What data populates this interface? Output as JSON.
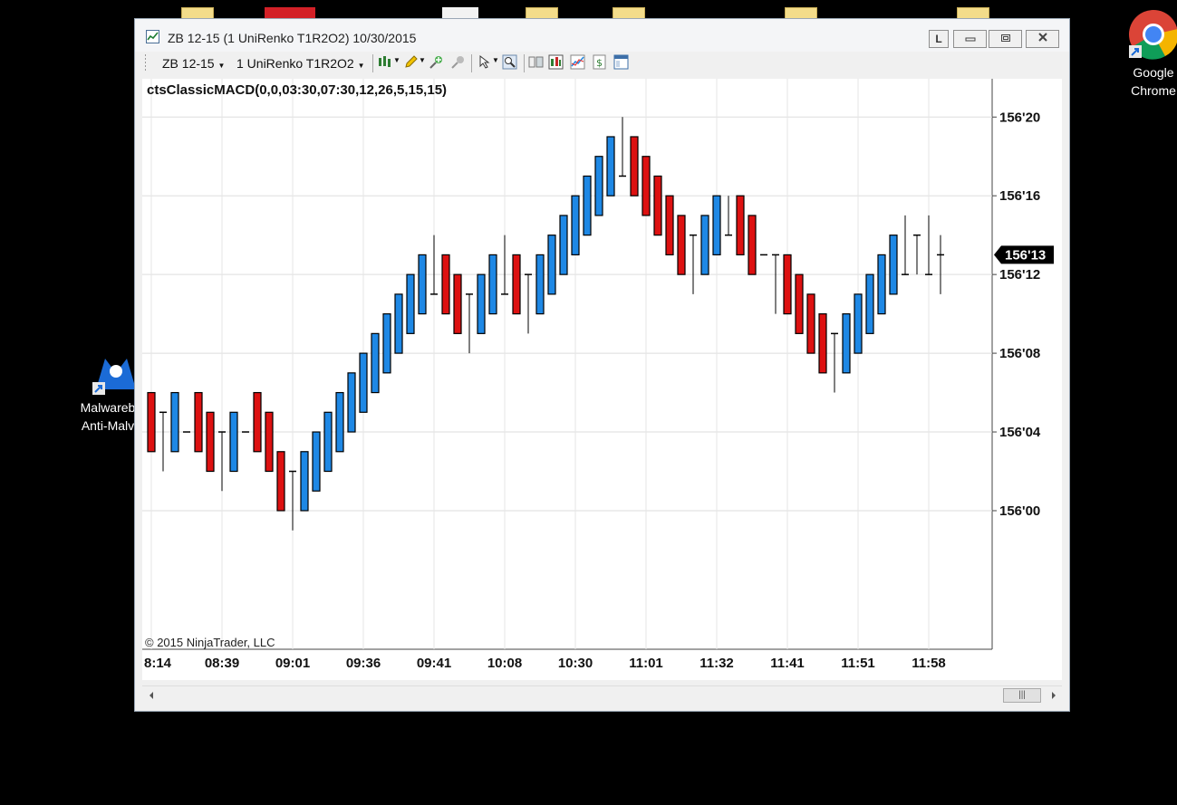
{
  "desktop": {
    "icons": [
      {
        "name": "malwarebytes",
        "label_line1": "Malwareb",
        "label_line2": "Anti-Malv"
      },
      {
        "name": "chrome",
        "label_line1": "Google",
        "label_line2": "Chrome"
      }
    ]
  },
  "window": {
    "title": "ZB 12-15 (1 UniRenko T1R2O2)  10/30/2015",
    "buttons": {
      "link": "L"
    }
  },
  "toolbar": {
    "instrument": "ZB 12-15",
    "period": "1 UniRenko T1R2O2"
  },
  "chart_data": {
    "type": "candlestick",
    "indicator_label": "ctsClassicMACD(0,0,03:30,07:30,12,26,5,15,15)",
    "copyright": "© 2015 NinjaTrader, LLC",
    "y_labels": [
      "156'20",
      "156'16",
      "156'12",
      "156'08",
      "156'04",
      "156'00"
    ],
    "y_label_values": [
      156.625,
      156.5,
      156.375,
      156.25,
      156.125,
      156.0
    ],
    "ylim": [
      155.78,
      156.68
    ],
    "last_price_label": "156'13",
    "last_price": 156.40625,
    "x_labels": [
      "8:14",
      "08:39",
      "09:01",
      "09:36",
      "09:41",
      "10:08",
      "10:30",
      "11:01",
      "11:32",
      "11:41",
      "11:51",
      "11:58"
    ],
    "x_label_bar_index": [
      0,
      6,
      12,
      18,
      24,
      30,
      36,
      42,
      48,
      54,
      60,
      66
    ],
    "colors": {
      "up": "#1e88e5",
      "down": "#dd1111",
      "doji": "#000000"
    },
    "bars": [
      {
        "o": 6,
        "h": 6,
        "l": 3,
        "c": 3
      },
      {
        "o": 5,
        "h": 5,
        "l": 2,
        "c": 5
      },
      {
        "o": 3,
        "h": 6,
        "l": 3,
        "c": 6
      },
      {
        "o": 4,
        "h": 4,
        "l": 4,
        "c": 4
      },
      {
        "o": 6,
        "h": 6,
        "l": 3,
        "c": 3
      },
      {
        "o": 5,
        "h": 5,
        "l": 2,
        "c": 2
      },
      {
        "o": 4,
        "h": 4,
        "l": 1,
        "c": 4
      },
      {
        "o": 2,
        "h": 5,
        "l": 2,
        "c": 5
      },
      {
        "o": 4,
        "h": 4,
        "l": 4,
        "c": 4
      },
      {
        "o": 6,
        "h": 6,
        "l": 3,
        "c": 3
      },
      {
        "o": 5,
        "h": 5,
        "l": 2,
        "c": 2
      },
      {
        "o": 3,
        "h": 3,
        "l": 0,
        "c": 0
      },
      {
        "o": 2,
        "h": 2,
        "l": -1,
        "c": 2
      },
      {
        "o": 0,
        "h": 3,
        "l": 0,
        "c": 3
      },
      {
        "o": 1,
        "h": 4,
        "l": 1,
        "c": 4
      },
      {
        "o": 2,
        "h": 5,
        "l": 2,
        "c": 5
      },
      {
        "o": 3,
        "h": 6,
        "l": 3,
        "c": 6
      },
      {
        "o": 4,
        "h": 7,
        "l": 4,
        "c": 7
      },
      {
        "o": 5,
        "h": 8,
        "l": 5,
        "c": 8
      },
      {
        "o": 6,
        "h": 9,
        "l": 6,
        "c": 9
      },
      {
        "o": 7,
        "h": 10,
        "l": 7,
        "c": 10
      },
      {
        "o": 8,
        "h": 11,
        "l": 8,
        "c": 11
      },
      {
        "o": 9,
        "h": 12,
        "l": 9,
        "c": 12
      },
      {
        "o": 10,
        "h": 13,
        "l": 10,
        "c": 13
      },
      {
        "o": 11,
        "h": 14,
        "l": 11,
        "c": 11
      },
      {
        "o": 13,
        "h": 13,
        "l": 10,
        "c": 10
      },
      {
        "o": 12,
        "h": 12,
        "l": 9,
        "c": 9
      },
      {
        "o": 11,
        "h": 11,
        "l": 8,
        "c": 11
      },
      {
        "o": 9,
        "h": 12,
        "l": 9,
        "c": 12
      },
      {
        "o": 10,
        "h": 13,
        "l": 10,
        "c": 13
      },
      {
        "o": 11,
        "h": 14,
        "l": 11,
        "c": 11
      },
      {
        "o": 13,
        "h": 13,
        "l": 10,
        "c": 10
      },
      {
        "o": 12,
        "h": 12,
        "l": 9,
        "c": 12
      },
      {
        "o": 10,
        "h": 13,
        "l": 10,
        "c": 13
      },
      {
        "o": 11,
        "h": 14,
        "l": 11,
        "c": 14
      },
      {
        "o": 12,
        "h": 15,
        "l": 12,
        "c": 15
      },
      {
        "o": 13,
        "h": 16,
        "l": 13,
        "c": 16
      },
      {
        "o": 14,
        "h": 17,
        "l": 14,
        "c": 17
      },
      {
        "o": 15,
        "h": 18,
        "l": 15,
        "c": 18
      },
      {
        "o": 16,
        "h": 19,
        "l": 16,
        "c": 19
      },
      {
        "o": 17,
        "h": 20,
        "l": 17,
        "c": 17
      },
      {
        "o": 19,
        "h": 19,
        "l": 16,
        "c": 16
      },
      {
        "o": 18,
        "h": 18,
        "l": 15,
        "c": 15
      },
      {
        "o": 17,
        "h": 17,
        "l": 14,
        "c": 14
      },
      {
        "o": 16,
        "h": 16,
        "l": 13,
        "c": 13
      },
      {
        "o": 15,
        "h": 15,
        "l": 12,
        "c": 12
      },
      {
        "o": 14,
        "h": 14,
        "l": 11,
        "c": 14
      },
      {
        "o": 12,
        "h": 15,
        "l": 12,
        "c": 15
      },
      {
        "o": 13,
        "h": 16,
        "l": 13,
        "c": 16
      },
      {
        "o": 14,
        "h": 16,
        "l": 14,
        "c": 14
      },
      {
        "o": 16,
        "h": 16,
        "l": 13,
        "c": 13
      },
      {
        "o": 15,
        "h": 15,
        "l": 12,
        "c": 12
      },
      {
        "o": 13,
        "h": 13,
        "l": 13,
        "c": 13
      },
      {
        "o": 13,
        "h": 13,
        "l": 10,
        "c": 13
      },
      {
        "o": 13,
        "h": 13,
        "l": 10,
        "c": 10
      },
      {
        "o": 12,
        "h": 12,
        "l": 9,
        "c": 9
      },
      {
        "o": 11,
        "h": 11,
        "l": 8,
        "c": 8
      },
      {
        "o": 10,
        "h": 10,
        "l": 7,
        "c": 7
      },
      {
        "o": 9,
        "h": 9,
        "l": 6,
        "c": 9
      },
      {
        "o": 7,
        "h": 10,
        "l": 7,
        "c": 10
      },
      {
        "o": 8,
        "h": 11,
        "l": 8,
        "c": 11
      },
      {
        "o": 9,
        "h": 12,
        "l": 9,
        "c": 12
      },
      {
        "o": 10,
        "h": 13,
        "l": 10,
        "c": 13
      },
      {
        "o": 11,
        "h": 14,
        "l": 11,
        "c": 14
      },
      {
        "o": 12,
        "h": 15,
        "l": 12,
        "c": 12
      },
      {
        "o": 14,
        "h": 14,
        "l": 12,
        "c": 14
      },
      {
        "o": 12,
        "h": 15,
        "l": 12,
        "c": 12
      },
      {
        "o": 13,
        "h": 14,
        "l": 11,
        "c": 13
      }
    ]
  }
}
